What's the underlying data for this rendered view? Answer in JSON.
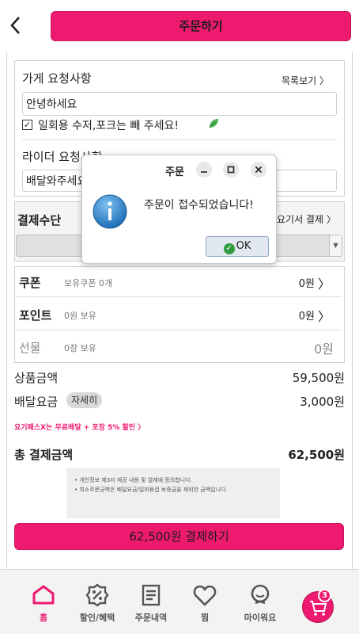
{
  "header": {
    "back_icon": "chevron-left-icon",
    "title": "주문하기"
  },
  "request": {
    "store_label": "가게 요청사항",
    "list_link": "목록보기 〉",
    "store_value": "안녕하세요",
    "utensils_checked": true,
    "utensils_label": "일회용 수저,포크는 빼 주세요!",
    "rider_label": "라이더 요청사항",
    "rider_value": "배달와주세요"
  },
  "payment": {
    "label": "결제수단",
    "right_label": "요기서 결제 〉",
    "selected": ""
  },
  "discounts": {
    "coupon": {
      "title": "쿠폰",
      "sub": "보유쿠폰 0개",
      "value": "0원",
      "chevron": "〉"
    },
    "points": {
      "title": "포인트",
      "sub": "0원 보유",
      "value": "0원",
      "chevron": "〉"
    },
    "gift": {
      "title": "선물",
      "sub": "0장 보유",
      "value": "0원"
    }
  },
  "summary": {
    "product_label": "상품금액",
    "product_value": "59,500원",
    "delivery_label": "배달요금",
    "detail_badge": "자세히",
    "delivery_value": "3,000원",
    "promo": "요기패스X는 무료배달 + 포장 5% 할인 〉",
    "total_label": "총 결제금액",
    "total_value": "62,500원"
  },
  "notice": {
    "line1": "• 개인정보 제3자 제공 내용 및 결제에 동의합니다.",
    "line2": "• 최소주문금액은 배달요금/일회용컵 보증금을 제외한 금액입니다."
  },
  "pay_button": "62,500원 결제하기",
  "bottom_nav": [
    {
      "label": "홈",
      "icon": "home-icon",
      "active": true
    },
    {
      "label": "할인/혜택",
      "icon": "discount-icon",
      "active": false
    },
    {
      "label": "주문내역",
      "icon": "receipt-icon",
      "active": false
    },
    {
      "label": "찜",
      "icon": "heart-icon",
      "active": false
    },
    {
      "label": "마이워요",
      "icon": "profile-icon",
      "active": false
    }
  ],
  "cart": {
    "icon": "cart-icon",
    "count": "3"
  },
  "dialog": {
    "title": "주문",
    "message": "주문이 접수되었습니다!",
    "ok_label": "OK",
    "icon": "info-icon"
  },
  "colors": {
    "accent": "#ee1a70",
    "panel_border": "#cfcfcf",
    "ok_green": "#2e9b3e"
  }
}
